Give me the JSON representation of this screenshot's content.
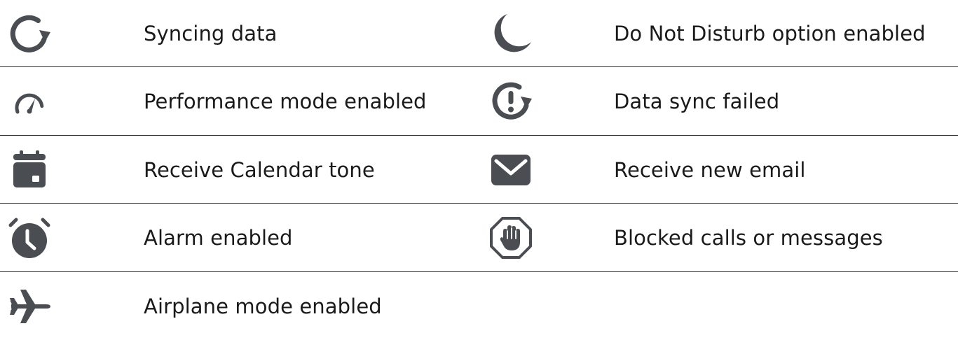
{
  "colors": {
    "icon": "#4a4d52",
    "text": "#1a1a1a",
    "divider": "#2a2a2a"
  },
  "rows": [
    {
      "left": {
        "icon": "sync-icon",
        "label": "Syncing data"
      },
      "right": {
        "icon": "moon-icon",
        "label": "Do Not Disturb option enabled"
      }
    },
    {
      "left": {
        "icon": "speedometer-icon",
        "label": "Performance mode enabled"
      },
      "right": {
        "icon": "sync-failed-icon",
        "label": "Data sync failed"
      }
    },
    {
      "left": {
        "icon": "calendar-icon",
        "label": "Receive Calendar tone"
      },
      "right": {
        "icon": "envelope-icon",
        "label": "Receive new email"
      }
    },
    {
      "left": {
        "icon": "alarm-clock-icon",
        "label": "Alarm enabled"
      },
      "right": {
        "icon": "blocked-hand-icon",
        "label": "Blocked calls or messages"
      }
    },
    {
      "left": {
        "icon": "airplane-icon",
        "label": "Airplane mode enabled"
      }
    }
  ]
}
